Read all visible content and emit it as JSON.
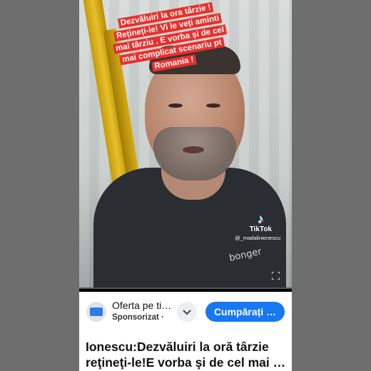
{
  "video": {
    "caption": "Dezvăluiri la ora târzie ! Rețineți-le! Vi le veți aminti mai târziu . E vorba și de cel mai complicat scenariu pt Romania !",
    "watermark_brand": "TikTok",
    "watermark_handle": "@_madalinionescu",
    "shirt_text": "bonger",
    "progress": 0.0
  },
  "ad": {
    "title": "Oferta pe ti…",
    "subtitle": "Sponsorizat ·",
    "cta_label": "Cumpărați …",
    "colors": {
      "cta": "#1877f2"
    }
  },
  "headline": {
    "text": "Ionescu:Dezvăluiri la oră târzie reţineţi-le!E vorba şi de cel mai …"
  }
}
